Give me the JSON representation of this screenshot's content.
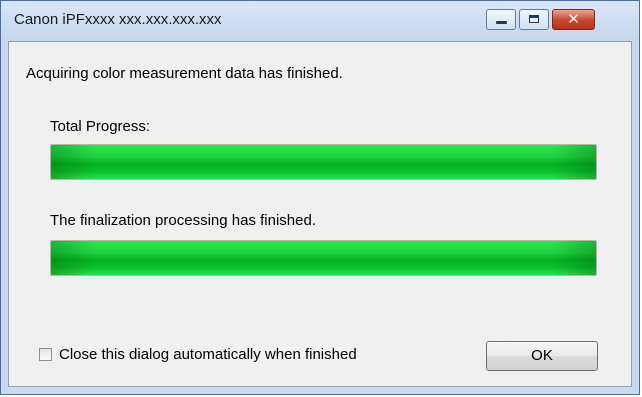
{
  "window": {
    "title": "Canon iPFxxxx xxx.xxx.xxx.xxx",
    "minimize_icon": "minimize-icon",
    "maximize_icon": "maximize-icon",
    "close_icon": "close-icon",
    "close_glyph": "✕"
  },
  "dialog": {
    "status_message": "Acquiring color measurement data has finished.",
    "total_progress_label": "Total Progress:",
    "total_progress_value": 1.0,
    "finalization_label": "The finalization processing has finished.",
    "finalization_progress_value": 1.0,
    "auto_close_checkbox_label": "Close this dialog automatically when finished",
    "auto_close_checked": false,
    "ok_button_label": "OK"
  },
  "colors": {
    "progress_green": "#1fd23f",
    "close_button_red": "#c9452f"
  }
}
